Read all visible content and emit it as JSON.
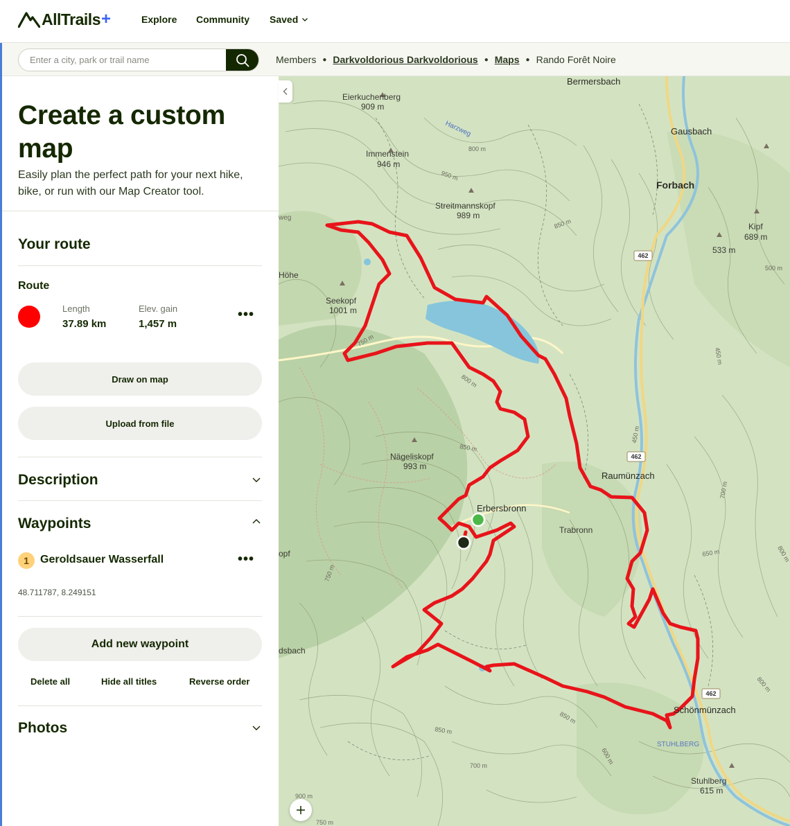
{
  "nav": {
    "logo_text": "AllTrails",
    "logo_plus": "+",
    "explore": "Explore",
    "community": "Community",
    "saved": "Saved"
  },
  "search": {
    "placeholder": "Enter a city, park or trail name"
  },
  "breadcrumb": {
    "items": [
      "Members",
      "Darkvoldorious Darkvoldorious",
      "Maps",
      "Rando Forêt Noire"
    ]
  },
  "intro": {
    "title": "Create a custom map",
    "subtitle": "Easily plan the perfect path for your next hike, bike, or run with our Map Creator tool."
  },
  "route_section": {
    "heading": "Your route",
    "route_label": "Route",
    "route_color": "#ff0000",
    "length_label": "Length",
    "length_value": "37.89 km",
    "elev_label": "Elev. gain",
    "elev_value": "1,457 m",
    "draw_button": "Draw on map",
    "upload_button": "Upload from file"
  },
  "description_section": {
    "heading": "Description"
  },
  "waypoints_section": {
    "heading": "Waypoints",
    "items": [
      {
        "number": "1",
        "name": "Geroldsauer Wasserfall",
        "coords": "48.711787, 8.249151"
      }
    ],
    "add_button": "Add new waypoint",
    "delete_all": "Delete all",
    "hide_titles": "Hide all titles",
    "reverse_order": "Reverse order"
  },
  "photos_section": {
    "heading": "Photos"
  },
  "map": {
    "places": [
      {
        "name": "Bermersbach"
      },
      {
        "name": "Eierkuchenberg",
        "elev": "909 m"
      },
      {
        "name": "Gausbach"
      },
      {
        "name": "Forbach"
      },
      {
        "name": "Immenstein",
        "elev": "946 m"
      },
      {
        "name": "Streitmannskopf",
        "elev": "989 m"
      },
      {
        "name": "Kipf",
        "elev": "689 m"
      },
      {
        "name": "",
        "elev": "533 m"
      },
      {
        "name": "Seekopf",
        "elev": "1001 m"
      },
      {
        "name": "Nägeliskopf",
        "elev": "993 m"
      },
      {
        "name": "Raumünzach"
      },
      {
        "name": "Erbersbronn"
      },
      {
        "name": "Trabronn"
      },
      {
        "name": "Schönmünzach"
      },
      {
        "name": "STUHLBERG"
      },
      {
        "name": "Stuhlberg",
        "elev": "615 m"
      },
      {
        "name": "Höhe"
      },
      {
        "name": "dsbach"
      },
      {
        "name": "opf"
      }
    ],
    "road_badges": [
      "462",
      "462",
      "462"
    ],
    "contour_labels": [
      "800 m",
      "950 m",
      "850 m",
      "750 m",
      "800 m",
      "850 m",
      "700 m",
      "750 m",
      "850 m",
      "700 m",
      "600 m",
      "650 m",
      "500 m",
      "450 m",
      "450 m",
      "900 m",
      "750 m",
      "800 m",
      "850 m",
      "800 m"
    ],
    "trail_labels": [
      "Harzweg",
      "weg"
    ],
    "route_color": "#e8141a",
    "start_marker_color": "#4cb848",
    "end_marker_color": "#1d2a17",
    "lake_color": "#86c5db"
  }
}
